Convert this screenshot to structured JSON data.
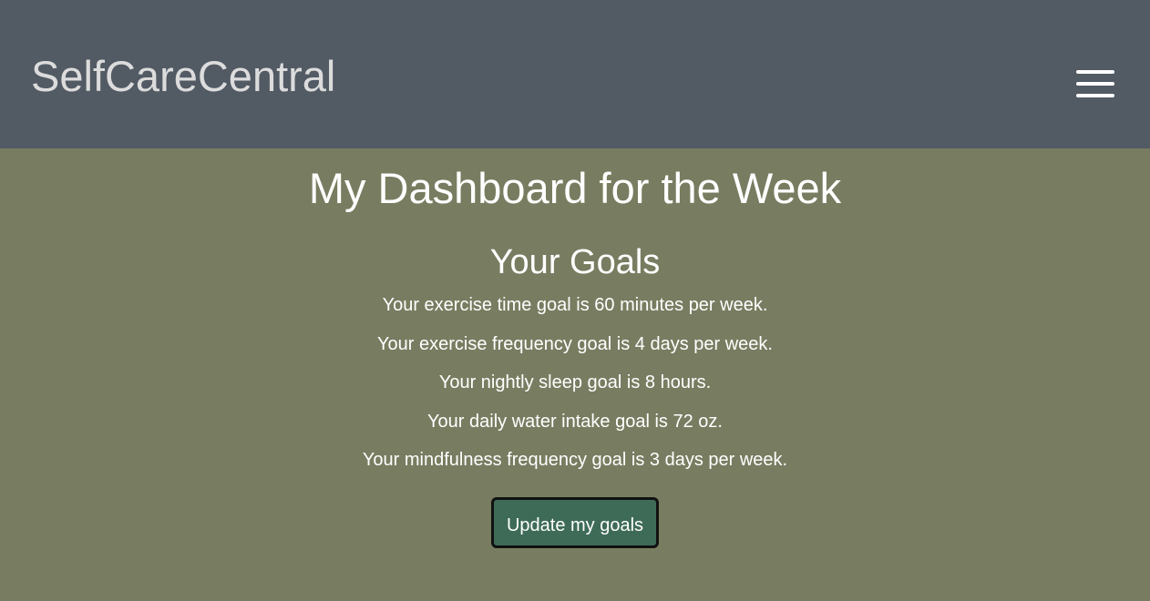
{
  "header": {
    "brand": "SelfCareCentral",
    "menu_icon": "hamburger-menu-icon"
  },
  "main": {
    "title": "My Dashboard for the Week",
    "goals_heading": "Your Goals",
    "goals": [
      "Your exercise time goal is 60 minutes per week.",
      "Your exercise frequency goal is 4 days per week.",
      "Your nightly sleep goal is 8 hours.",
      "Your daily water intake goal is 72 oz.",
      "Your mindfulness frequency goal is 3 days per week."
    ],
    "update_button": "Update my goals"
  },
  "colors": {
    "header_bg": "#525a64",
    "page_bg": "#787d61",
    "button_bg": "#3e6b58"
  }
}
